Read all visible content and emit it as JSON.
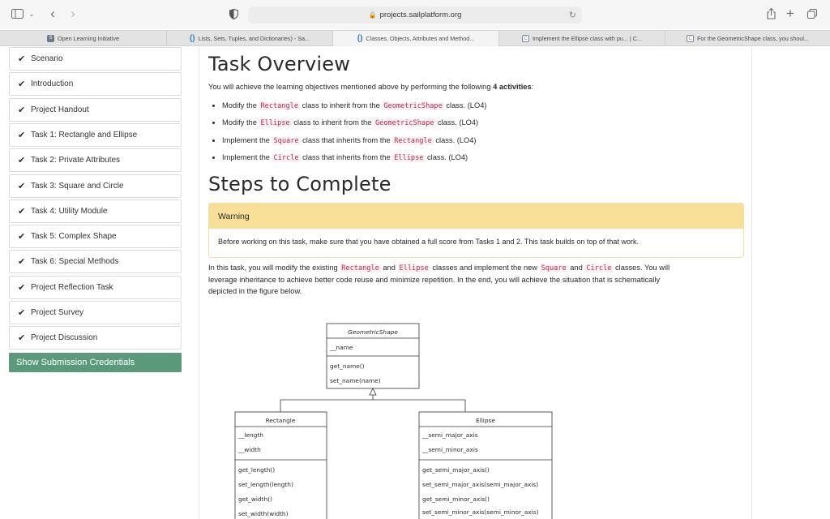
{
  "browser": {
    "url": "projects.sailplatform.org",
    "tabs": [
      {
        "label": "Open Learning Initiative",
        "favicon": "S"
      },
      {
        "label": "Lists, Sets, Tuples, and Dictionaries) - Sa...",
        "favicon": "()"
      },
      {
        "label": "Classes, Objects, Attributes and Method...",
        "favicon": "()"
      },
      {
        "label": "Implement the Ellipse class with pu... | C...",
        "favicon": "C"
      },
      {
        "label": "For the GeometricShape class, you shoul...",
        "favicon": "C"
      }
    ]
  },
  "sidebar": {
    "items": [
      {
        "label": "Scenario"
      },
      {
        "label": "Introduction"
      },
      {
        "label": "Project Handout"
      },
      {
        "label": "Task 1: Rectangle and Ellipse"
      },
      {
        "label": "Task 2: Private Attributes"
      },
      {
        "label": "Task 3: Square and Circle"
      },
      {
        "label": "Task 4: Utility Module"
      },
      {
        "label": "Task 5: Complex Shape"
      },
      {
        "label": "Task 6: Special Methods"
      },
      {
        "label": "Project Reflection Task"
      },
      {
        "label": "Project Survey"
      },
      {
        "label": "Project Discussion"
      }
    ],
    "submit_label": "Show Submission Credentials"
  },
  "main": {
    "overview_title": "Task Overview",
    "intro_prefix": "You will achieve the learning objectives mentioned above by performing the following ",
    "intro_bold": "4 activities",
    "intro_suffix": ":",
    "activities": [
      {
        "pre": "Modify the ",
        "c1": "Rectangle",
        "mid": " class to inherit from the ",
        "c2": "GeometricShape",
        "post": " class. (LO4)"
      },
      {
        "pre": "Modify the ",
        "c1": "Ellipse",
        "mid": " class to inherit from the ",
        "c2": "GeometricShape",
        "post": " class. (LO4)"
      },
      {
        "pre": "Implement the ",
        "c1": "Square",
        "mid": " class that inherits from the ",
        "c2": "Rectangle",
        "post": " class. (LO4)"
      },
      {
        "pre": "Implement the ",
        "c1": "Circle",
        "mid": " class that inherits from the ",
        "c2": "Ellipse",
        "post": " class. (LO4)"
      }
    ],
    "steps_title": "Steps to Complete",
    "warning": {
      "title": "Warning",
      "body": "Before working on this task, make sure that you have obtained a full score from Tasks 1 and 2. This task builds on top of that work."
    },
    "task_text": {
      "p1": "In this task, you will modify the existing ",
      "c1": "Rectangle",
      "p2": " and ",
      "c2": "Ellipse",
      "p3": " classes and implement the new ",
      "c3": "Square",
      "p4": " and ",
      "c4": "Circle",
      "p5": " classes. You will",
      "line2": "leverage inheritance to achieve better code reuse and minimize repetition. In the end, you will achieve the situation that is schematically",
      "line3": "depicted in the figure below."
    }
  },
  "uml": {
    "geometric": {
      "name": "GeometricShape",
      "attrs": [
        "__name"
      ],
      "methods": [
        "get_name()",
        "set_name(name)"
      ]
    },
    "rectangle": {
      "name": "Rectangle",
      "attrs": [
        "__length",
        "__width"
      ],
      "methods": [
        "get_length()",
        "set_length(length)",
        "get_width()",
        "set_width(width)"
      ]
    },
    "ellipse": {
      "name": "Ellipse",
      "attrs": [
        "__semi_major_axis",
        "__semi_minor_axis"
      ],
      "methods": [
        "get_semi_major_axis()",
        "set_semi_major_axis(semi_major_axis)",
        "get_semi_minor_axis()",
        "set_semi_minor_axis(semi_minor_axis)"
      ]
    }
  },
  "colors": {
    "accent": "#5a9a7a",
    "code": "#c7254e",
    "warning_header": "#f8df97"
  }
}
